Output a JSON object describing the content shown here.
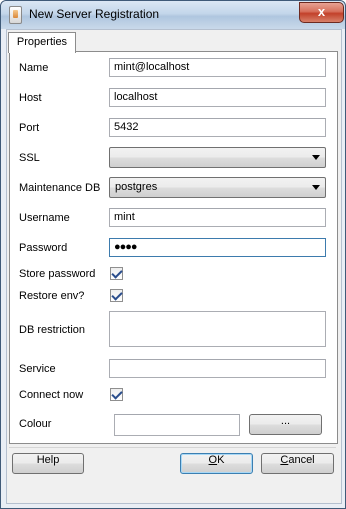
{
  "window": {
    "title": "New Server Registration",
    "close_glyph": "x"
  },
  "tabs": [
    {
      "label": "Properties"
    }
  ],
  "fields": {
    "name": {
      "label": "Name",
      "value": "mint@localhost"
    },
    "host": {
      "label": "Host",
      "value": "localhost"
    },
    "port": {
      "label": "Port",
      "value": "5432"
    },
    "ssl": {
      "label": "SSL",
      "value": ""
    },
    "maintenance_db": {
      "label": "Maintenance DB",
      "value": "postgres"
    },
    "username": {
      "label": "Username",
      "value": "mint"
    },
    "password": {
      "label": "Password",
      "value": "●●●●"
    },
    "store_password": {
      "label": "Store password",
      "checked": true
    },
    "restore_env": {
      "label": "Restore env?",
      "checked": true
    },
    "db_restriction": {
      "label": "DB restriction",
      "value": ""
    },
    "service": {
      "label": "Service",
      "value": ""
    },
    "connect_now": {
      "label": "Connect now",
      "checked": true
    },
    "colour": {
      "label": "Colour",
      "value": "",
      "button_label": "..."
    }
  },
  "buttons": {
    "help": {
      "label": "Help"
    },
    "ok": {
      "label_first": "O",
      "label_rest": "K"
    },
    "cancel": {
      "label_first": "C",
      "label_rest": "ancel"
    }
  },
  "icons": {
    "app": "app-document-icon",
    "close": "close-icon",
    "checkmark": "checkmark-icon",
    "dropdown": "chevron-down-icon"
  }
}
